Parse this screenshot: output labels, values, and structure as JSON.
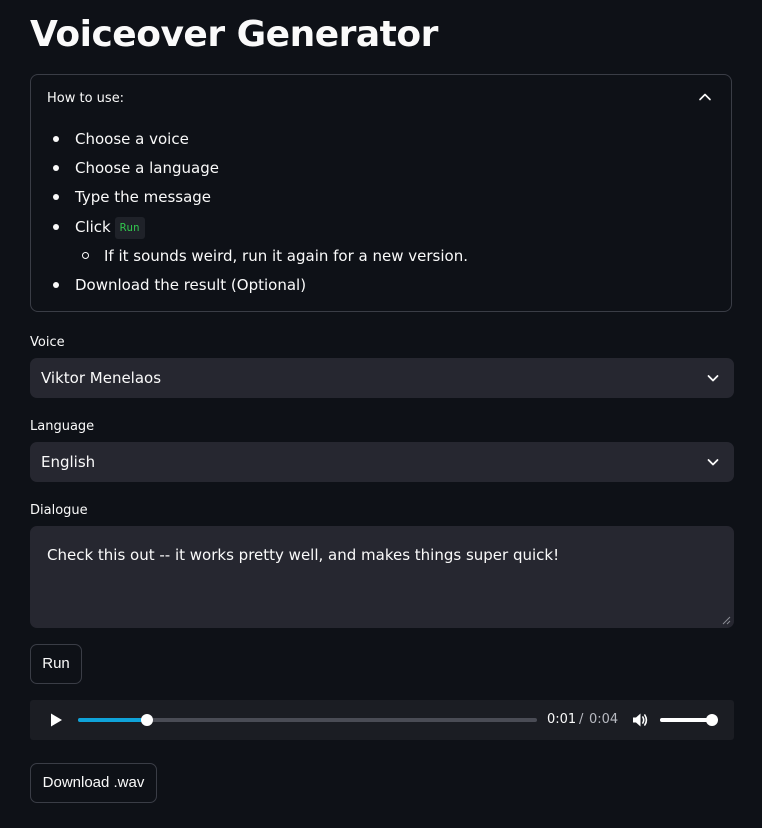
{
  "title": "Voiceover Generator",
  "instructions": {
    "header": "How to use:",
    "steps": [
      "Choose a voice",
      "Choose a language",
      "Type the message",
      "Click",
      "Download the result (Optional)"
    ],
    "run_code": "Run",
    "substep": "If it sounds weird, run it again for a new version."
  },
  "voice": {
    "label": "Voice",
    "value": "Viktor Menelaos"
  },
  "language": {
    "label": "Language",
    "value": "English"
  },
  "dialogue": {
    "label": "Dialogue",
    "value": "Check this out -- it works pretty well, and makes things super quick!"
  },
  "run_button": "Run",
  "player": {
    "current_time": "0:01",
    "separator": "/",
    "duration": "0:04",
    "progress": 0.15,
    "volume": 1.0
  },
  "download_button": "Download .wav",
  "colors": {
    "background": "#0e1117",
    "input_bg": "#262730",
    "accent": "#0fa3d9",
    "code_text": "#31c44d"
  }
}
